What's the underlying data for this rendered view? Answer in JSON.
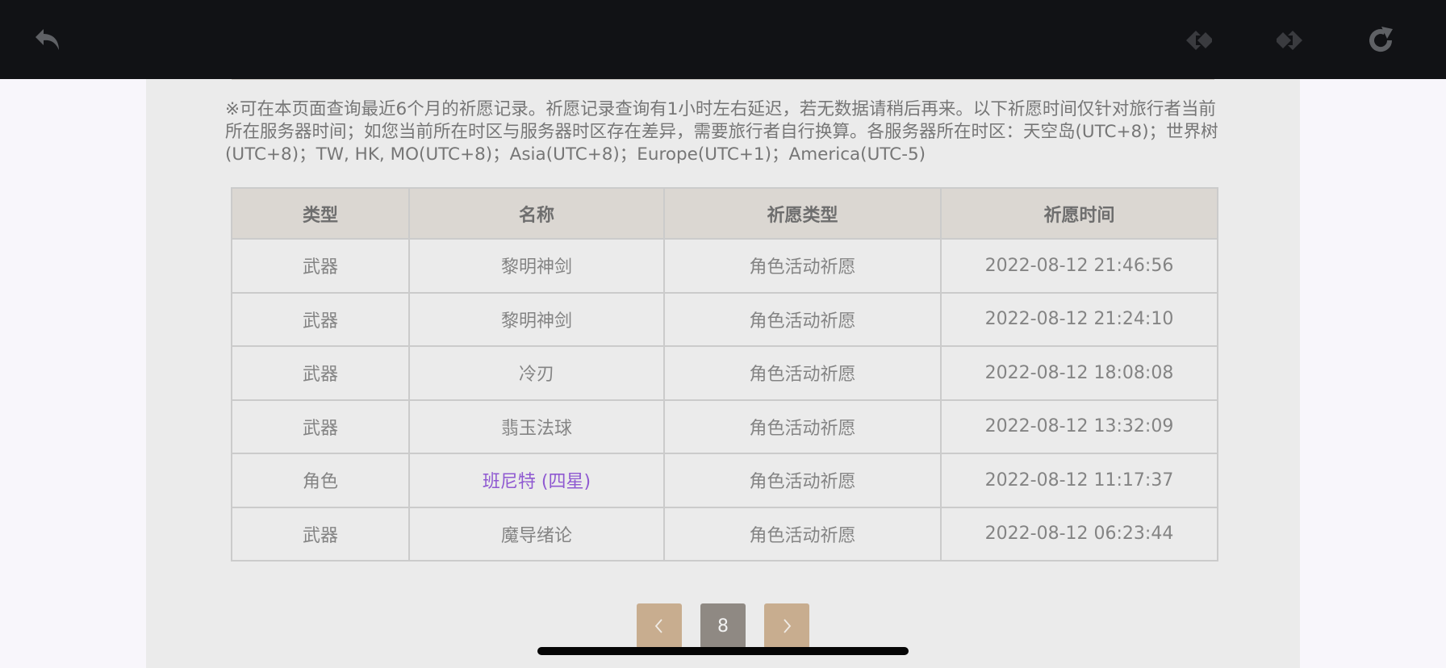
{
  "notice": "※可在本页面查询最近6个月的祈愿记录。祈愿记录查询有1小时左右延迟，若无数据请稍后再来。以下祈愿时间仅针对旅行者当前所在服务器时间；如您当前所在时区与服务器时区存在差异，需要旅行者自行换算。各服务器所在时区：天空岛(UTC+8)；世界树(UTC+8)；TW, HK, MO(UTC+8)；Asia(UTC+8)；Europe(UTC+1)；America(UTC-5)",
  "table": {
    "headers": [
      "类型",
      "名称",
      "祈愿类型",
      "祈愿时间"
    ],
    "rows": [
      {
        "type": "武器",
        "name": "黎明神剑",
        "wish_type": "角色活动祈愿",
        "time": "2022-08-12 21:46:56"
      },
      {
        "type": "武器",
        "name": "黎明神剑",
        "wish_type": "角色活动祈愿",
        "time": "2022-08-12 21:24:10"
      },
      {
        "type": "武器",
        "name": "冷刃",
        "wish_type": "角色活动祈愿",
        "time": "2022-08-12 18:08:08"
      },
      {
        "type": "武器",
        "name": "翡玉法球",
        "wish_type": "角色活动祈愿",
        "time": "2022-08-12 13:32:09"
      },
      {
        "type": "角色",
        "name": "班尼特 (四星)",
        "wish_type": "角色活动祈愿",
        "time": "2022-08-12 11:17:37"
      },
      {
        "type": "武器",
        "name": "魔导绪论",
        "wish_type": "角色活动祈愿",
        "time": "2022-08-12 06:23:44"
      }
    ]
  },
  "pagination": {
    "current_page": "8"
  },
  "colors": {
    "toolbar_bg": "#111215",
    "panel_bg": "#ebebeb",
    "header_bg": "#dbd7d2",
    "four_star_text": "#8f59d1",
    "pager_button": "#c8ad8f",
    "pager_current": "#8f8983"
  },
  "icons": {
    "back": "undo-arrow-icon",
    "prev": "diamond-arrow-left-icon",
    "next": "diamond-arrow-right-icon",
    "refresh": "refresh-icon",
    "pager_prev": "chevron-left-icon",
    "pager_next": "chevron-right-icon"
  }
}
